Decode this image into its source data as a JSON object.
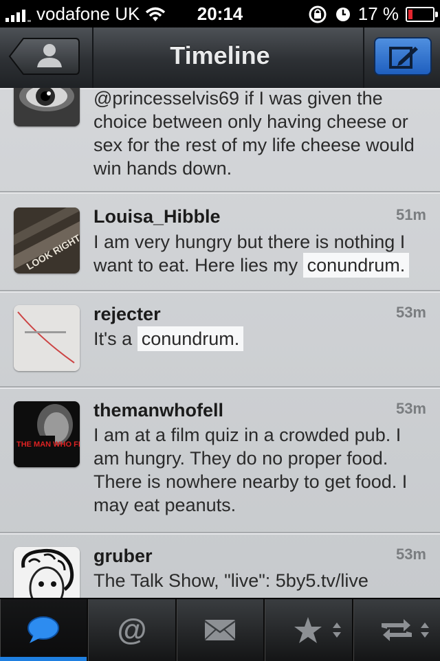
{
  "status_bar": {
    "carrier": "vodafone UK",
    "time": "20:14",
    "battery": "17 %",
    "battery_level": 0.17,
    "signal_icon": "signal-bars-icon",
    "wifi_icon": "wifi-icon",
    "rotation_lock_icon": "rotation-lock-icon",
    "alarm_icon": "alarm-icon"
  },
  "navbar": {
    "title": "Timeline",
    "back_icon": "accounts-person-icon",
    "compose_icon": "compose-pencil-icon"
  },
  "timeline": [
    {
      "user": "",
      "time": "",
      "text_plain": "@princesselvis69 if I was given the choice between only having cheese or sex for the rest of my life cheese would win hands down.",
      "text_highlight": ""
    },
    {
      "user": "Louisa_Hibble",
      "time": "51m",
      "text_plain": "I am very hungry but there is nothing I want to eat. Here lies my ",
      "text_highlight": "conundrum."
    },
    {
      "user": "rejecter",
      "time": "53m",
      "text_plain": "It's a ",
      "text_highlight": "conundrum."
    },
    {
      "user": "themanwhofell",
      "time": "53m",
      "text_plain": "I am at a film quiz in a crowded pub. I am hungry. They do no proper food. There is nowhere nearby to get food. I may eat peanuts.",
      "text_highlight": ""
    },
    {
      "user": "gruber",
      "time": "53m",
      "text_plain": "The Talk Show, \"live\": 5by5.tv/live",
      "text_highlight": ""
    }
  ],
  "avatar_text": {
    "louisa": "LOOK RIGHT",
    "themanwhofell": "THE MAN WHO FELL ASLEEP"
  },
  "tabbar": {
    "tabs": [
      {
        "icon": "speech-bubble-icon",
        "active": true
      },
      {
        "icon": "at-mention-icon",
        "active": false
      },
      {
        "icon": "envelope-icon",
        "active": false
      },
      {
        "icon": "star-icon",
        "active": false
      },
      {
        "icon": "retweet-icon",
        "active": false
      }
    ]
  },
  "colors": {
    "accent": "#1f7fe0",
    "highlight_bg": "#f7f8f9",
    "battery_low": "#e3262f"
  }
}
